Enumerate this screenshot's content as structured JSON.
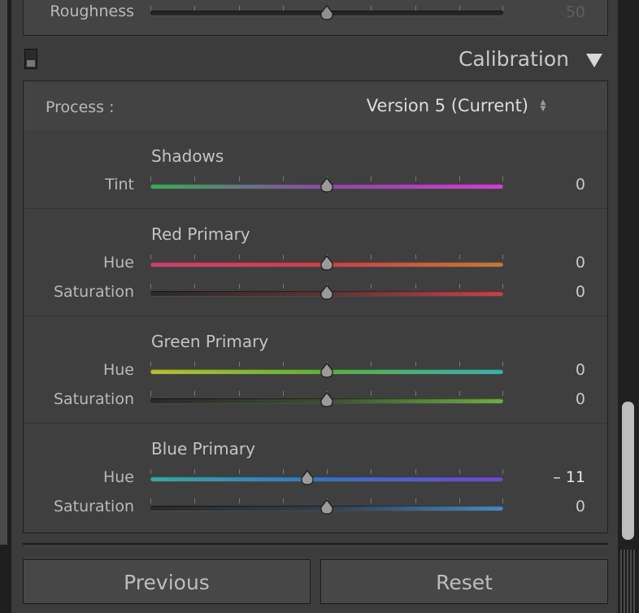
{
  "roughness": {
    "label": "Roughness",
    "value": "50",
    "level": 0.5
  },
  "calibration": {
    "title": "Calibration",
    "process_label": "Process :",
    "process_value": "Version 5 (Current)"
  },
  "shadows": {
    "title": "Shadows",
    "tint": {
      "label": "Tint",
      "value": "0",
      "level": 0.5
    }
  },
  "red_primary": {
    "title": "Red Primary",
    "hue": {
      "label": "Hue",
      "value": "0",
      "level": 0.5
    },
    "saturation": {
      "label": "Saturation",
      "value": "0",
      "level": 0.5
    }
  },
  "green_primary": {
    "title": "Green Primary",
    "hue": {
      "label": "Hue",
      "value": "0",
      "level": 0.5
    },
    "saturation": {
      "label": "Saturation",
      "value": "0",
      "level": 0.5
    }
  },
  "blue_primary": {
    "title": "Blue Primary",
    "hue": {
      "label": "Hue",
      "value": "– 11",
      "level": 0.445
    },
    "saturation": {
      "label": "Saturation",
      "value": "0",
      "level": 0.5
    }
  },
  "buttons": {
    "previous": "Previous",
    "reset": "Reset"
  },
  "colors": {
    "panel": "#3c3c3c",
    "tint_gradient": [
      "#3ca85a",
      "#8a4aa0",
      "#d040d0"
    ],
    "red_hue_gradient": [
      "#c8426e",
      "#c8424a",
      "#c07a38"
    ],
    "red_sat_gradient": [
      "#2a2a2a",
      "#5a3434",
      "#c8424a"
    ],
    "green_hue_gradient": [
      "#b8c030",
      "#5cb040",
      "#3cb0b0"
    ],
    "green_sat_gradient": [
      "#2a2a2a",
      "#3c5030",
      "#6cb040"
    ],
    "blue_hue_gradient": [
      "#38a8a0",
      "#3870c0",
      "#7048c8"
    ],
    "blue_sat_gradient": [
      "#2a2a2a",
      "#30404e",
      "#4888c0"
    ]
  }
}
